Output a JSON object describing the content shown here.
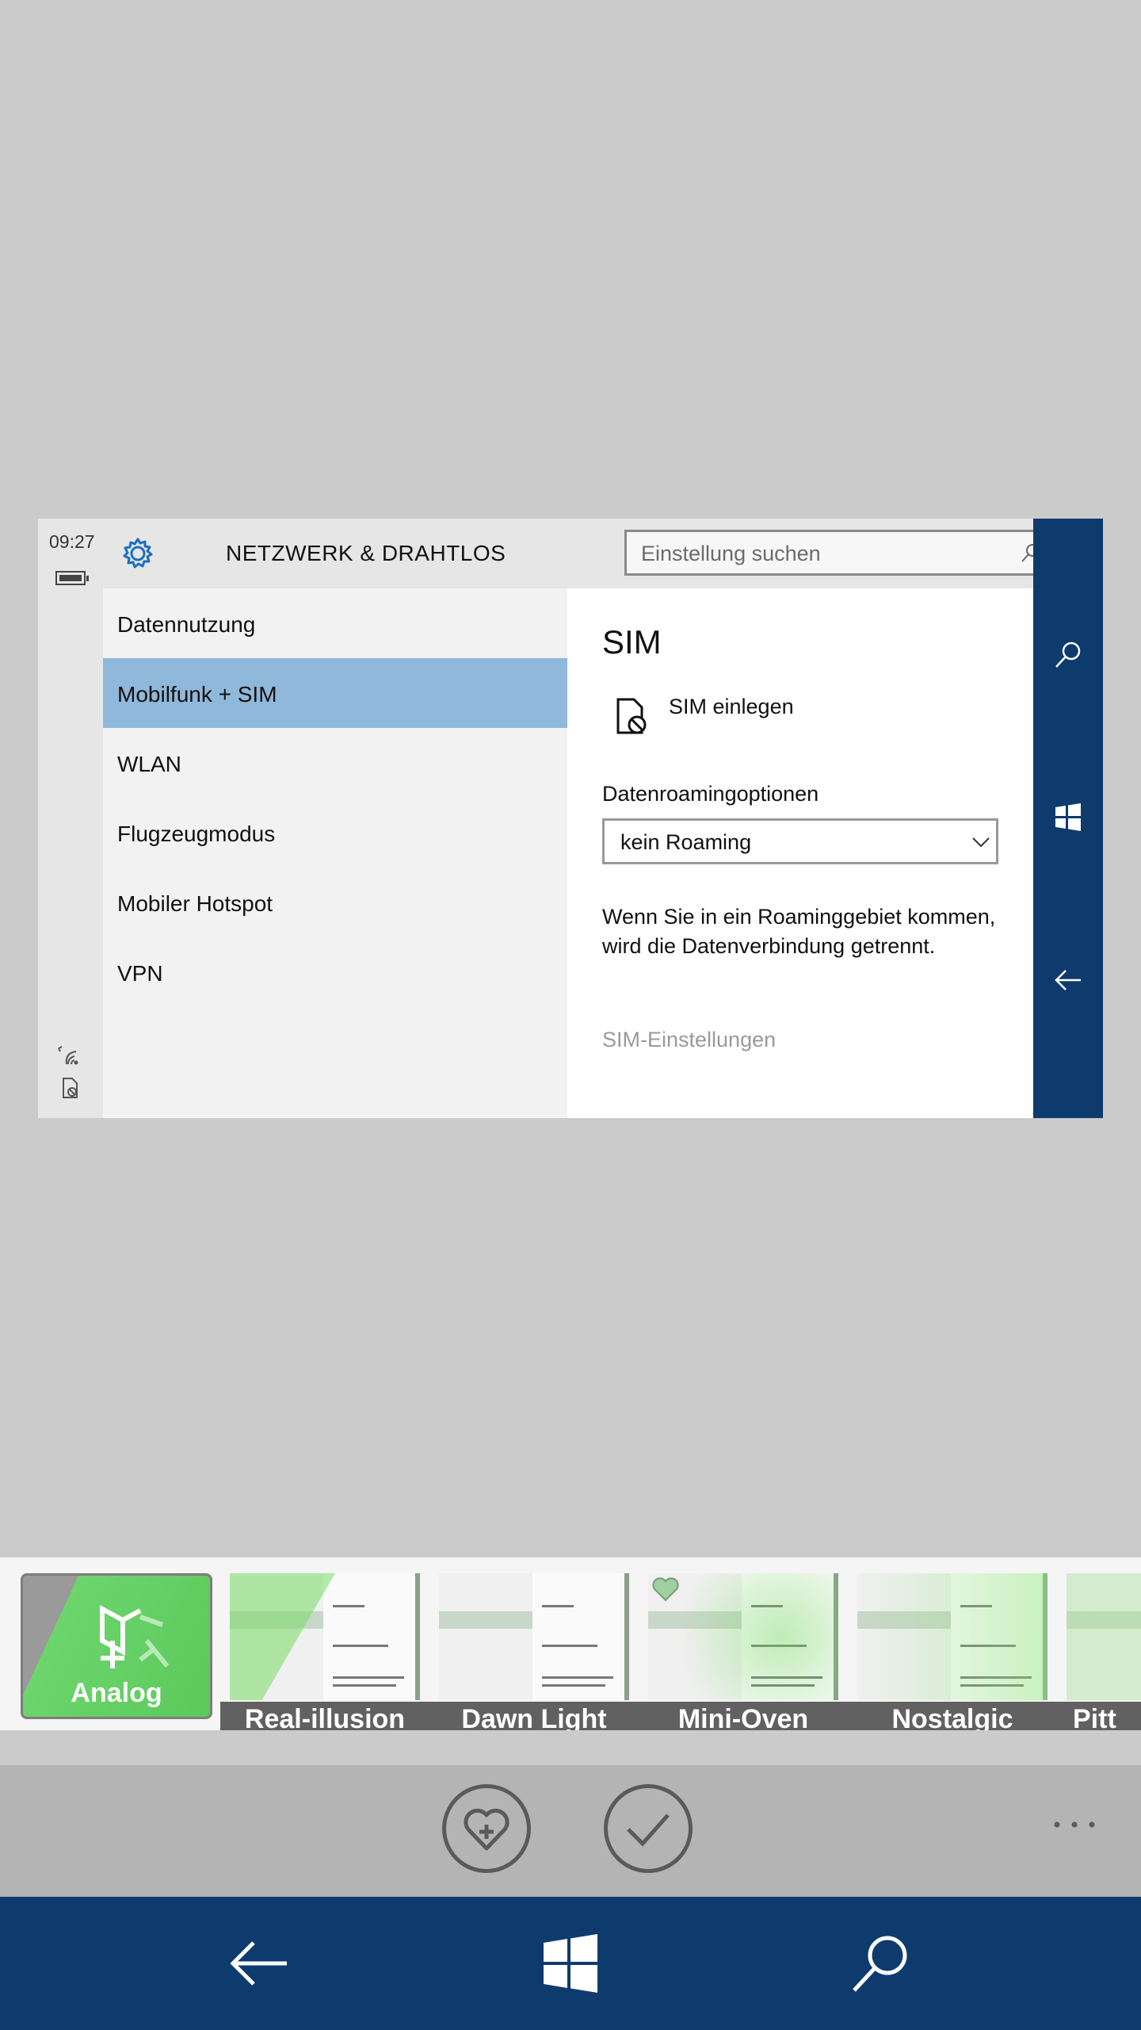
{
  "preview": {
    "status": {
      "time": "09:27"
    },
    "header": {
      "title": "NETZWERK & DRAHTLOS",
      "search_placeholder": "Einstellung suchen"
    },
    "nav_items": [
      {
        "label": "Datennutzung"
      },
      {
        "label": "Mobilfunk + SIM",
        "selected": true
      },
      {
        "label": "WLAN"
      },
      {
        "label": "Flugzeugmodus"
      },
      {
        "label": "Mobiler Hotspot"
      },
      {
        "label": "VPN"
      }
    ],
    "content": {
      "heading": "SIM",
      "sim_insert": "SIM einlegen",
      "roaming_label": "Datenroamingoptionen",
      "roaming_value": "kein Roaming",
      "roaming_description": "Wenn Sie in ein Roaminggebiet kommen, wird die Datenverbindung getrennt.",
      "sim_settings_link": "SIM-Einstellungen"
    },
    "sidebar_icons": [
      "search-icon",
      "windows-icon",
      "back-arrow-icon"
    ]
  },
  "filters": {
    "active": "Analog",
    "items": [
      {
        "label": "Real-illusion"
      },
      {
        "label": "Dawn Light"
      },
      {
        "label": "Mini-Oven"
      },
      {
        "label": "Nostalgic"
      },
      {
        "label": "Pitt"
      }
    ]
  },
  "actions": [
    "favorite-add-icon",
    "checkmark-icon",
    "more-icon"
  ],
  "system_nav": [
    "back-icon",
    "windows-start-icon",
    "search-icon"
  ],
  "colors": {
    "accent_blue": "#0d3b6e",
    "selection": "#90b8da",
    "filter_green": "#5cc95c"
  }
}
